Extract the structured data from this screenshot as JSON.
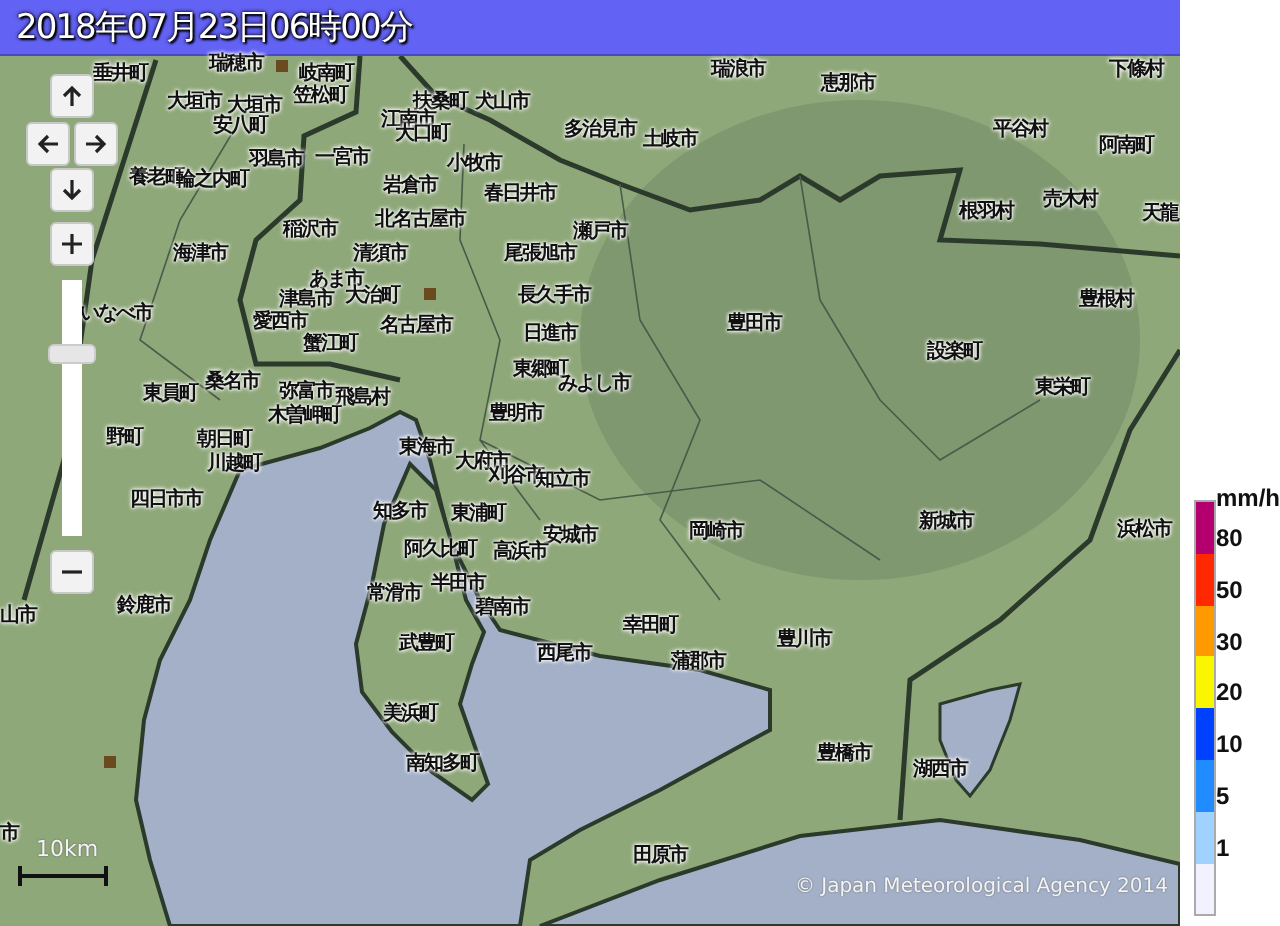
{
  "header": {
    "title": "2018年07月23日06時00分"
  },
  "map_controls": {
    "zoom_slider": {
      "level": 0.73
    }
  },
  "places": [
    "垂井町",
    "瑞穂市",
    "岐南町",
    "瑞浪市",
    "下條村",
    "笠松町",
    "恵那市",
    "大垣市",
    "大垣市",
    "扶桑町",
    "犬山市",
    "安八町",
    "江南市",
    "大口町",
    "多治見市",
    "土岐市",
    "平谷村",
    "阿南町",
    "羽島市",
    "一宮市",
    "小牧市",
    "養老町",
    "輪之内町",
    "岩倉市",
    "春日井市",
    "売木村",
    "北名古屋市",
    "根羽村",
    "天龍",
    "稲沢市",
    "瀬戸市",
    "海津市",
    "清須市",
    "尾張旭市",
    "あま市",
    "津島市",
    "大治町",
    "長久手市",
    "豊根村",
    "いなべ市",
    "愛西市",
    "名古屋市",
    "日進市",
    "豊田市",
    "蟹江町",
    "設楽町",
    "東員町",
    "桑名市",
    "弥富市",
    "飛島村",
    "東郷町",
    "みよし市",
    "東栄町",
    "木曽岬町",
    "豊明市",
    "野町",
    "朝日町",
    "東海市",
    "川越町",
    "大府市",
    "刈谷市",
    "知立市",
    "四日市市",
    "知多市",
    "東浦町",
    "安城市",
    "岡崎市",
    "新城市",
    "浜松市",
    "阿久比町",
    "高浜市",
    "山市",
    "鈴鹿市",
    "常滑市",
    "武豊町",
    "半田市",
    "碧南市",
    "西尾市",
    "幸田町",
    "蒲郡市",
    "豊川市",
    "美浜町",
    "南知多町",
    "豊橋市",
    "湖西市",
    "市",
    "田原市"
  ],
  "scale": {
    "label": "10km"
  },
  "attribution": "© Japan Meteorological Agency 2014",
  "legend": {
    "unit": "mm/h",
    "bins": [
      {
        "color": "#b4006e",
        "label": "80"
      },
      {
        "color": "#ff2800",
        "label": "50"
      },
      {
        "color": "#ff9900",
        "label": "30"
      },
      {
        "color": "#faf500",
        "label": "20"
      },
      {
        "color": "#0041ff",
        "label": "10"
      },
      {
        "color": "#218cff",
        "label": "5"
      },
      {
        "color": "#a0d2ff",
        "label": "1"
      },
      {
        "color": "#f2f2ff"
      }
    ]
  }
}
